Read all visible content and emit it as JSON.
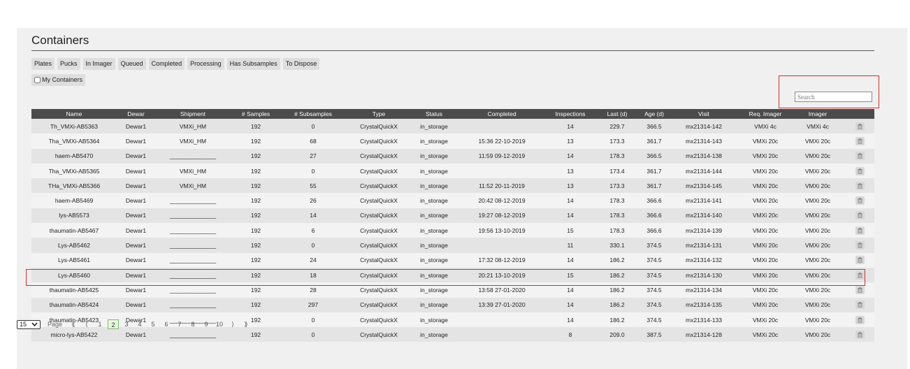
{
  "page": {
    "title": "Containers"
  },
  "filters": [
    "Plates",
    "Pucks",
    "In Imager",
    "Queued",
    "Completed",
    "Processing",
    "Has Subsamples",
    "To Dispose"
  ],
  "my_containers": {
    "label": "My Containers",
    "checked": false
  },
  "search": {
    "placeholder": "Search"
  },
  "table": {
    "columns": [
      "Name",
      "Dewar",
      "Shipment",
      "# Samples",
      "# Subsamples",
      "Type",
      "Status",
      "Completed",
      "Inspections",
      "Last (d)",
      "Age (d)",
      "Visit",
      "Req. Imager",
      "Imager",
      ""
    ],
    "rows": [
      [
        "Th_VMXi-AB5363",
        "Dewar1",
        "VMXi_HM",
        "192",
        "0",
        "CrystalQuickX",
        "in_storage",
        "",
        "14",
        "229.7",
        "366.5",
        "mx21314-142",
        "VMXi 4c",
        "VMXi 4c"
      ],
      [
        "Tha_VMXi-AB5364",
        "Dewar1",
        "VMXi_HM",
        "192",
        "68",
        "CrystalQuickX",
        "in_storage",
        "15:36 22-10-2019",
        "13",
        "173.3",
        "361.7",
        "mx21314-143",
        "VMXi 20c",
        "VMXi 20c"
      ],
      [
        "haem-AB5470",
        "Dewar1",
        "______________",
        "192",
        "27",
        "CrystalQuickX",
        "in_storage",
        "11:59 09-12-2019",
        "14",
        "178.3",
        "366.5",
        "mx21314-138",
        "VMXi 20c",
        "VMXi 20c"
      ],
      [
        "Tha_VMXi-AB5365",
        "Dewar1",
        "VMXi_HM",
        "192",
        "0",
        "CrystalQuickX",
        "in_storage",
        "",
        "13",
        "173.4",
        "361.7",
        "mx21314-144",
        "VMXi 20c",
        "VMXi 20c"
      ],
      [
        "THa_VMXi-AB5366",
        "Dewar1",
        "VMXi_HM",
        "192",
        "55",
        "CrystalQuickX",
        "in_storage",
        "11:52 20-11-2019",
        "13",
        "173.3",
        "361.7",
        "mx21314-145",
        "VMXi 20c",
        "VMXi 20c"
      ],
      [
        "haem-AB5469",
        "Dewar1",
        "______________",
        "192",
        "26",
        "CrystalQuickX",
        "in_storage",
        "20:42 08-12-2019",
        "14",
        "178.3",
        "366.6",
        "mx21314-141",
        "VMXi 20c",
        "VMXi 20c"
      ],
      [
        "lys-AB5573",
        "Dewar1",
        "______________",
        "192",
        "14",
        "CrystalQuickX",
        "in_storage",
        "19:27 08-12-2019",
        "14",
        "178.3",
        "366.6",
        "mx21314-140",
        "VMXi 20c",
        "VMXi 20c"
      ],
      [
        "thaumatin-AB5467",
        "Dewar1",
        "______________",
        "192",
        "6",
        "CrystalQuickX",
        "in_storage",
        "19:56 13-10-2019",
        "15",
        "178.3",
        "366.6",
        "mx21314-139",
        "VMXi 20c",
        "VMXi 20c"
      ],
      [
        "Lys-AB5462",
        "Dewar1",
        "______________",
        "192",
        "0",
        "CrystalQuickX",
        "in_storage",
        "",
        "11",
        "330.1",
        "374.5",
        "mx21314-131",
        "VMXi 20c",
        "VMXi 20c"
      ],
      [
        "Lys-AB5461",
        "Dewar1",
        "______________",
        "192",
        "24",
        "CrystalQuickX",
        "in_storage",
        "17:32 08-12-2019",
        "14",
        "186.2",
        "374.5",
        "mx21314-132",
        "VMXi 20c",
        "VMXi 20c"
      ],
      [
        "Lys-AB5460",
        "Dewar1",
        "______________",
        "192",
        "18",
        "CrystalQuickX",
        "in_storage",
        "20:21 13-10-2019",
        "15",
        "186.2",
        "374.5",
        "mx21314-130",
        "VMXi 20c",
        "VMXi 20c"
      ],
      [
        "thaumatin-AB5425",
        "Dewar1",
        "______________",
        "192",
        "28",
        "CrystalQuickX",
        "in_storage",
        "13:58 27-01-2020",
        "14",
        "186.2",
        "374.5",
        "mx21314-134",
        "VMXi 20c",
        "VMXi 20c"
      ],
      [
        "thaumatin-AB5424",
        "Dewar1",
        "______________",
        "192",
        "297",
        "CrystalQuickX",
        "in_storage",
        "13:39 27-01-2020",
        "14",
        "186.2",
        "374.5",
        "mx21314-135",
        "VMXi 20c",
        "VMXi 20c"
      ],
      [
        "thaumatin-AB5423",
        "Dewar1",
        "______________",
        "192",
        "0",
        "CrystalQuickX",
        "in_storage",
        "",
        "14",
        "186.2",
        "374.5",
        "mx21314-133",
        "VMXi 20c",
        "VMXi 20c"
      ],
      [
        "micro-lys-AB5422",
        "Dewar1",
        "______________",
        "192",
        "0",
        "CrystalQuickX",
        "in_storage",
        "",
        "8",
        "209.0",
        "387.5",
        "mx21314-128",
        "VMXi 20c",
        "VMXi 20c"
      ]
    ]
  },
  "pagination": {
    "page_size": "15",
    "label": "Page",
    "first": "⟪",
    "prev": "⟨",
    "next": "⟩",
    "last": "⟫",
    "pages": [
      "1",
      "2",
      "3",
      "4",
      "5",
      "6",
      "7",
      "8",
      "9",
      "10"
    ],
    "current": "2"
  },
  "icons": {
    "delete": "trash-icon",
    "dropdown": "chevron-down-icon"
  },
  "colors": {
    "highlight": "#d93025",
    "header": "#4b4b4b",
    "current_page": "#7cbf6a"
  }
}
